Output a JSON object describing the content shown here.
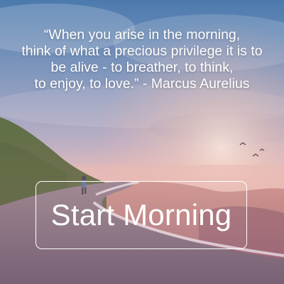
{
  "quote": {
    "lines": [
      "“When you arise in the morning,",
      "think of what a precious privilege it is to",
      "be alive - to breather, to think,",
      "to enjoy, to love.” - Marcus Aurelius"
    ]
  },
  "start_button": {
    "label": "Start Morning"
  },
  "colors": {
    "sky_top": "#5b86b4",
    "sky_mid": "#9aa6c6",
    "horizon_glow": "#f3c6b2",
    "hill_left": "#3d5a2c",
    "road": "#6c6478",
    "overlay_pink": "#e7a2a6",
    "text": "#ffffff"
  },
  "icons": {
    "background": "coastal-road-sunrise-photo"
  }
}
